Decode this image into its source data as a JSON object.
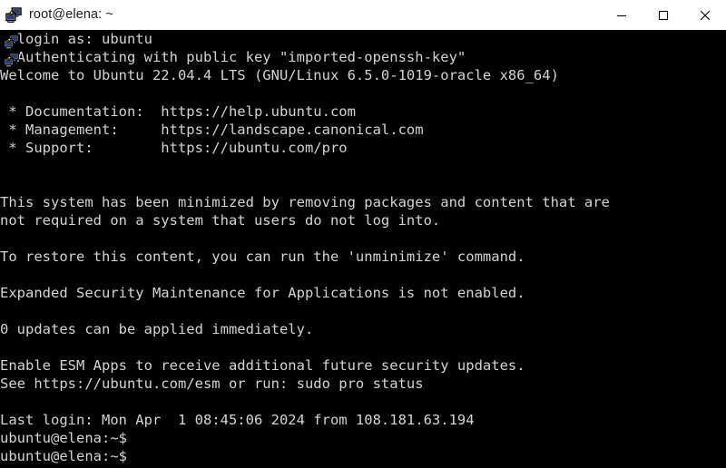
{
  "window": {
    "title": "root@elena: ~",
    "icon": "putty-icon",
    "controls": [
      {
        "name": "minimize-button",
        "glyph": "minimize-icon",
        "label": "Minimize"
      },
      {
        "name": "maximize-button",
        "glyph": "maximize-icon",
        "label": "Maximize"
      },
      {
        "name": "close-button",
        "glyph": "close-icon",
        "label": "Close"
      }
    ]
  },
  "colors": {
    "titlebar_background": "#ffffff",
    "titlebar_text": "#1c1c1c",
    "terminal_background": "#000000",
    "terminal_text": "#d3d3d3"
  },
  "terminal": {
    "rows": [
      "  login as: ubuntu",
      "  Authenticating with public key \"imported-openssh-key\"",
      "Welcome to Ubuntu 22.04.4 LTS (GNU/Linux 6.5.0-1019-oracle x86_64)",
      "",
      " * Documentation:  https://help.ubuntu.com",
      " * Management:     https://landscape.canonical.com",
      " * Support:        https://ubuntu.com/pro",
      "",
      "",
      "This system has been minimized by removing packages and content that are",
      "not required on a system that users do not log into.",
      "",
      "To restore this content, you can run the 'unminimize' command.",
      "",
      "Expanded Security Maintenance for Applications is not enabled.",
      "",
      "0 updates can be applied immediately.",
      "",
      "Enable ESM Apps to receive additional future security updates.",
      "See https://ubuntu.com/esm or run: sudo pro status",
      "",
      "Last login: Mon Apr  1 08:45:06 2024 from 108.181.63.194",
      "ubuntu@elena:~$",
      "ubuntu@elena:~$"
    ],
    "prompt": "ubuntu@elena:~$",
    "session": {
      "login_user": "ubuntu",
      "auth_method": "public key",
      "auth_key_name": "imported-openssh-key",
      "distro": "Ubuntu 22.04.4 LTS",
      "kernel": "GNU/Linux 6.5.0-1019-oracle x86_64",
      "documentation_url": "https://help.ubuntu.com",
      "management_url": "https://landscape.canonical.com",
      "support_url": "https://ubuntu.com/pro",
      "esm_url": "https://ubuntu.com/esm",
      "esm_status": "not enabled",
      "updates_available": "0",
      "last_login_day": "Mon",
      "last_login_date": "Apr  1",
      "last_login_time": "08:45:06",
      "last_login_year": "2024",
      "last_login_from": "108.181.63.194",
      "hostname": "elena",
      "user": "ubuntu"
    }
  }
}
